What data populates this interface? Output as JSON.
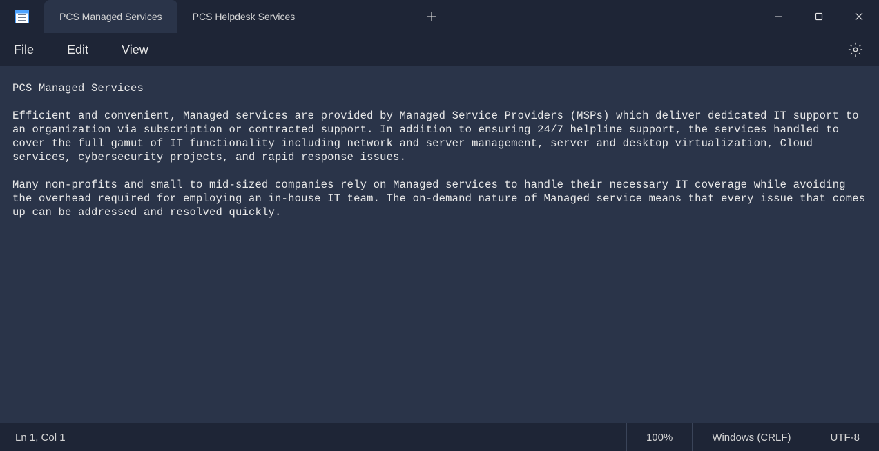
{
  "tabs": [
    {
      "title": "PCS Managed Services",
      "active": true
    },
    {
      "title": "PCS Helpdesk Services",
      "active": false
    }
  ],
  "menu": {
    "file": "File",
    "edit": "Edit",
    "view": "View"
  },
  "document": {
    "content": "PCS Managed Services\n\nEfficient and convenient, Managed services are provided by Managed Service Providers (MSPs) which deliver dedicated IT support to an organization via subscription or contracted support. In addition to ensuring 24/7 helpline support, the services handled to cover the full gamut of IT functionality including network and server management, server and desktop virtualization, Cloud services, cybersecurity projects, and rapid response issues.\n\nMany non-profits and small to mid-sized companies rely on Managed services to handle their necessary IT coverage while avoiding the overhead required for employing an in-house IT team. The on-demand nature of Managed service means that every issue that comes up can be addressed and resolved quickly."
  },
  "status": {
    "cursor": "Ln 1, Col 1",
    "zoom": "100%",
    "line_ending": "Windows (CRLF)",
    "encoding": "UTF-8"
  }
}
